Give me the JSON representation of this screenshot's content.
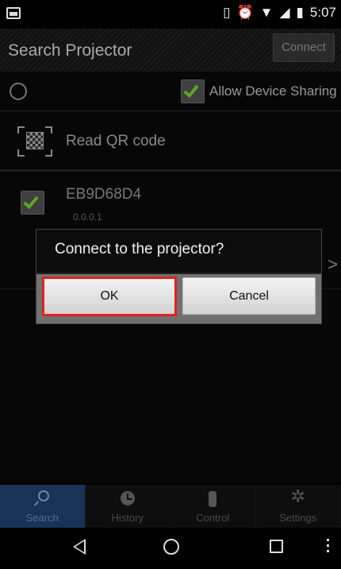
{
  "status_bar": {
    "time": "5:07",
    "icons": [
      "screenshot-icon",
      "vibrate-icon",
      "alarm-icon",
      "wifi-icon",
      "signal-icon",
      "battery-icon"
    ]
  },
  "app_bar": {
    "title": "Search Projector",
    "connect_label": "Connect"
  },
  "content": {
    "device_sharing_label": "Allow Device Sharing",
    "device_sharing_checked": true,
    "qr_label": "Read QR code",
    "devices": [
      {
        "name": "EB9D68D4",
        "address": "0.0.0.1",
        "checked": true
      }
    ]
  },
  "dialog": {
    "title": "Connect to the projector?",
    "ok_label": "OK",
    "cancel_label": "Cancel"
  },
  "tabs": [
    {
      "label": "Search",
      "icon": "search-icon",
      "active": true
    },
    {
      "label": "History",
      "icon": "history-icon",
      "active": false
    },
    {
      "label": "Control",
      "icon": "remote-icon",
      "active": false
    },
    {
      "label": "Settings",
      "icon": "gear-icon",
      "active": false
    }
  ],
  "colors": {
    "accent_check": "#5fa624",
    "active_tab": "#173457",
    "highlight": "#e2231a"
  }
}
